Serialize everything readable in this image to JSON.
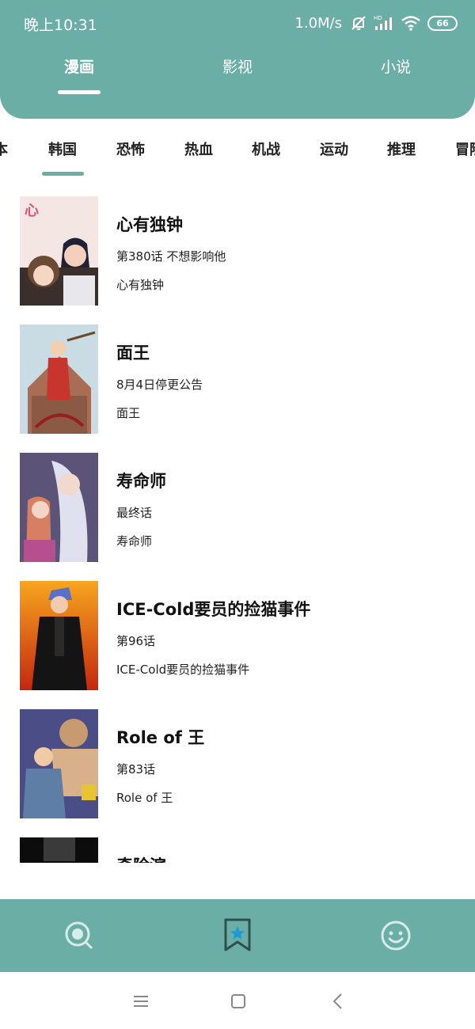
{
  "status_bar": {
    "time": "晚上10:31",
    "net_speed": "1.0M/s",
    "battery": "66",
    "icons": [
      "mute-bell-icon",
      "hd-signal-icon",
      "wifi-icon",
      "battery-icon"
    ]
  },
  "top_tabs": [
    {
      "label": "漫画",
      "active": true
    },
    {
      "label": "影视",
      "active": false
    },
    {
      "label": "小说",
      "active": false
    }
  ],
  "categories": [
    {
      "label": "本"
    },
    {
      "label": "韩国",
      "active": true
    },
    {
      "label": "恐怖"
    },
    {
      "label": "热血"
    },
    {
      "label": "机战"
    },
    {
      "label": "运动"
    },
    {
      "label": "推理"
    },
    {
      "label": "冒险"
    }
  ],
  "comics": [
    {
      "title": "心有独钟",
      "chapter": "第380话 不想影响他",
      "name": "心有独钟"
    },
    {
      "title": "面王",
      "chapter": "8月4日停更公告",
      "name": "面王"
    },
    {
      "title": "寿命师",
      "chapter": "最终话",
      "name": "寿命师"
    },
    {
      "title": "ICE-Cold要员的捡猫事件",
      "chapter": "第96话",
      "name": "ICE-Cold要员的捡猫事件"
    },
    {
      "title": "Role of 王",
      "chapter": "第83话",
      "name": "Role of 王"
    },
    {
      "title": "奇险滨",
      "chapter": "",
      "name": ""
    }
  ],
  "bottom_nav": [
    {
      "icon": "search-icon",
      "active": false
    },
    {
      "icon": "bookmark-star-icon",
      "active": true
    },
    {
      "icon": "smiley-icon",
      "active": false
    }
  ],
  "system_nav": [
    "menu-icon",
    "home-icon",
    "back-icon"
  ],
  "colors": {
    "accent": "#6aaea6",
    "star": "#1e9bd7",
    "text": "#111111"
  }
}
